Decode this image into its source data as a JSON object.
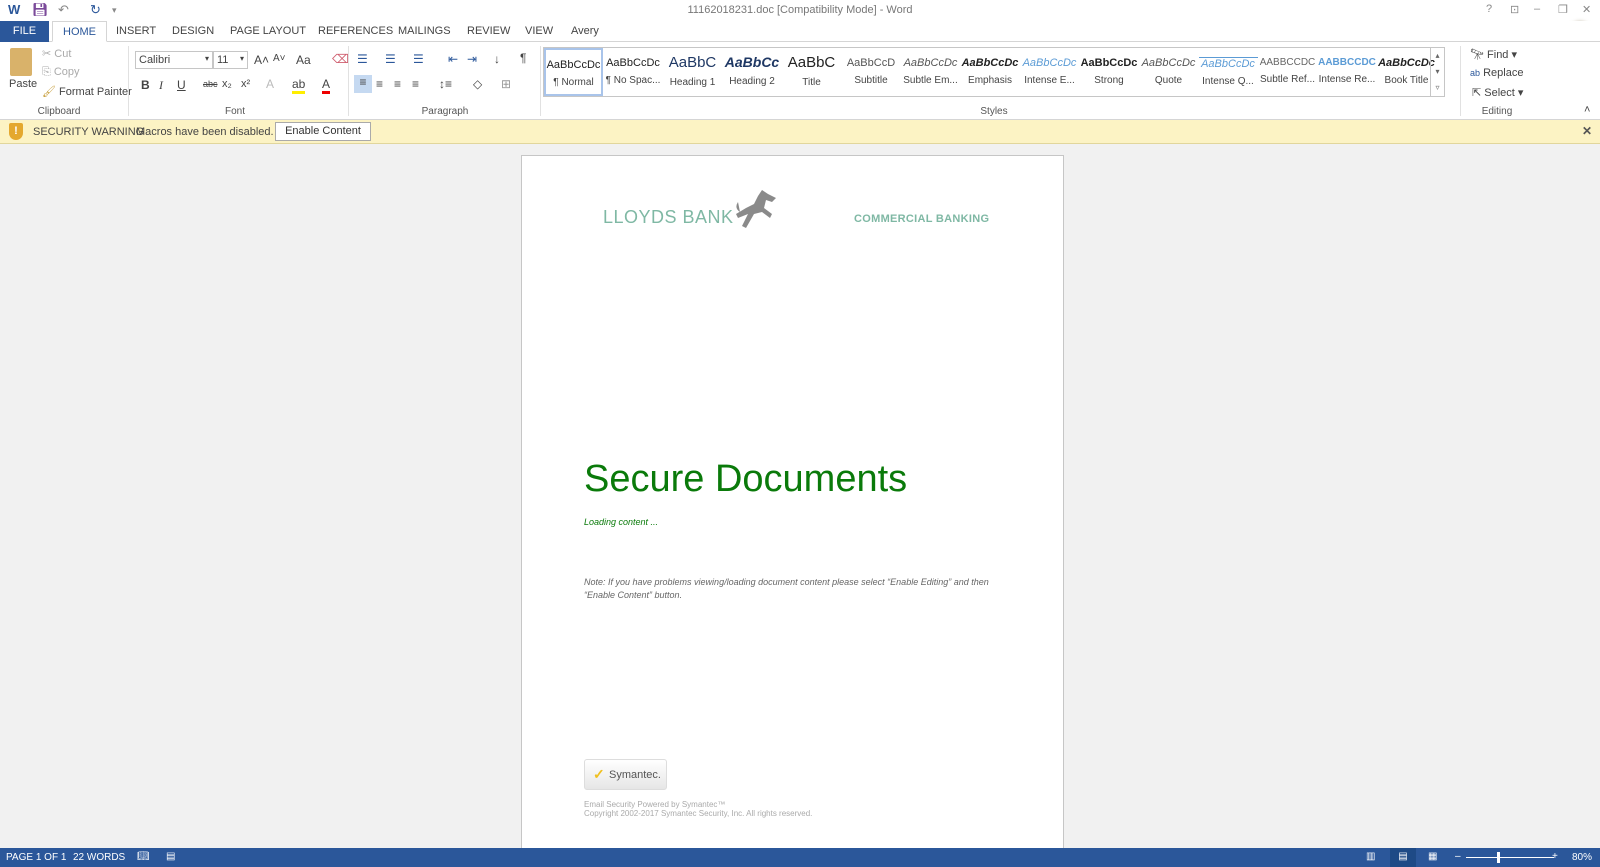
{
  "window": {
    "title": "11162018231.doc [Compatibility Mode] - Word",
    "help": "?",
    "min": "–",
    "restore": "❐",
    "close": "✕"
  },
  "tabs": [
    "FILE",
    "HOME",
    "INSERT",
    "DESIGN",
    "PAGE LAYOUT",
    "REFERENCES",
    "MAILINGS",
    "REVIEW",
    "VIEW",
    "Avery"
  ],
  "clipboard": {
    "paste": "Paste",
    "cut": "Cut",
    "copy": "Copy",
    "format_painter": "Format Painter",
    "label": "Clipboard"
  },
  "font": {
    "name": "Calibri",
    "size": "11",
    "label": "Font",
    "bold": "B",
    "italic": "I",
    "underline": "U",
    "strike": "abc",
    "sub": "x₂",
    "sup": "x²",
    "case": "Aa"
  },
  "paragraph": {
    "label": "Paragraph",
    "pilcrow": "¶"
  },
  "styles": {
    "label": "Styles",
    "items": [
      {
        "preview": "AaBbCcDc",
        "name": "¶ Normal"
      },
      {
        "preview": "AaBbCcDc",
        "name": "¶ No Spac..."
      },
      {
        "preview": "AaBbC",
        "name": "Heading 1"
      },
      {
        "preview": "AaBbCc",
        "name": "Heading 2"
      },
      {
        "preview": "AaBbC",
        "name": "Title"
      },
      {
        "preview": "AaBbCcD",
        "name": "Subtitle"
      },
      {
        "preview": "AaBbCcDc",
        "name": "Subtle Em..."
      },
      {
        "preview": "AaBbCcDc",
        "name": "Emphasis"
      },
      {
        "preview": "AaBbCcDc",
        "name": "Intense E..."
      },
      {
        "preview": "AaBbCcDc",
        "name": "Strong"
      },
      {
        "preview": "AaBbCcDc",
        "name": "Quote"
      },
      {
        "preview": "AaBbCcDc",
        "name": "Intense Q..."
      },
      {
        "preview": "AABBCCDC",
        "name": "Subtle Ref..."
      },
      {
        "preview": "AABBCCDC",
        "name": "Intense Re..."
      },
      {
        "preview": "AaBbCcDc",
        "name": "Book Title"
      }
    ]
  },
  "editing": {
    "find": "Find",
    "replace": "Replace",
    "select": "Select",
    "label": "Editing"
  },
  "warning": {
    "title": "SECURITY WARNING",
    "message": "Macros have been disabled.",
    "button": "Enable Content"
  },
  "document": {
    "brand": "LLOYDS BANK",
    "division": "COMMERCIAL BANKING",
    "heading": "Secure Documents",
    "loading": "Loading content ...",
    "note_line1": "Note:  If you have problems viewing/loading document content please select “Enable Editing” and then",
    "note_line2": "“Enable Content” button.",
    "badge": "Symantec.",
    "footer1": "Email Security Powered by Symantec™",
    "footer2": "Copyright 2002-2017 Symantec Security, Inc. All rights reserved."
  },
  "status": {
    "page": "PAGE 1 OF 1",
    "words": "22 WORDS",
    "zoom": "80%"
  },
  "colors": {
    "accent": "#2b579a",
    "heading": "#0a7a0a",
    "brand": "#7fb8a4"
  }
}
